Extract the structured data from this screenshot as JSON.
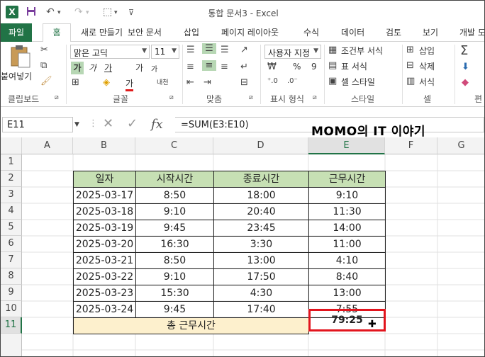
{
  "window": {
    "title": "통합 문서3 - Excel",
    "app_icon": "X"
  },
  "tabs": {
    "file": "파일",
    "items": [
      "홈",
      "새로 만들기",
      "삽입",
      "페이지 레이아웃",
      "수식",
      "데이터",
      "검토",
      "보기",
      "개발 도"
    ]
  },
  "ribbon": {
    "clipboard": {
      "paste": "붙여넣기",
      "label": "클립보드"
    },
    "font": {
      "name": "맑은 고딕",
      "size": "11",
      "bold": "가",
      "italic": "가",
      "underline": "가",
      "grow": "가",
      "shrink": "가",
      "color": "가",
      "phonetic": "내천",
      "label": "글꼴"
    },
    "align": {
      "label": "맞춤"
    },
    "number": {
      "format": "사용자 지정",
      "percent": "%",
      "comma": "9",
      "label": "표시 형식"
    },
    "styles": {
      "cond": "조건부 서식",
      "table": "표 서식",
      "cell": "셀 스타일",
      "label": "스타일"
    },
    "cells": {
      "insert": "삽입",
      "delete": "삭제",
      "format": "서식",
      "label": "셀"
    },
    "edit": {
      "label": "편"
    }
  },
  "formula_bar": {
    "name_box": "E11",
    "formula": "=SUM(E3:E10)",
    "fx": "fx"
  },
  "watermark": "MOMO의 IT 이야기",
  "columns": [
    "A",
    "B",
    "C",
    "D",
    "E",
    "F",
    "G"
  ],
  "rows": [
    "1",
    "2",
    "3",
    "4",
    "5",
    "6",
    "7",
    "8",
    "9",
    "10",
    "11"
  ],
  "table": {
    "headers": [
      "일자",
      "시작시간",
      "종료시간",
      "근무시간"
    ],
    "rows": [
      [
        "2025-03-17",
        "8:50",
        "18:00",
        "9:10"
      ],
      [
        "2025-03-18",
        "9:10",
        "20:40",
        "11:30"
      ],
      [
        "2025-03-19",
        "9:45",
        "23:45",
        "14:00"
      ],
      [
        "2025-03-20",
        "16:30",
        "3:30",
        "11:00"
      ],
      [
        "2025-03-21",
        "8:50",
        "13:00",
        "4:10"
      ],
      [
        "2025-03-22",
        "9:10",
        "17:50",
        "8:40"
      ],
      [
        "2025-03-23",
        "15:30",
        "4:30",
        "13:00"
      ],
      [
        "2025-03-24",
        "9:45",
        "17:40",
        "7:55"
      ]
    ],
    "total_label": "총 근무시간",
    "total_value": "79:25"
  }
}
